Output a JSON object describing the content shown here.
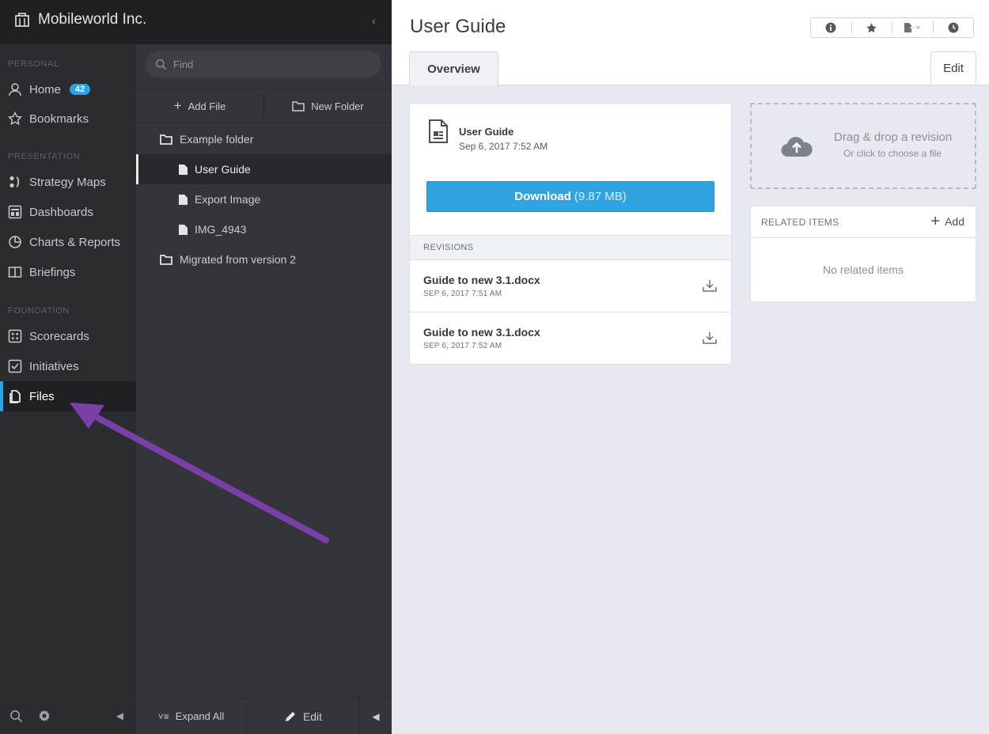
{
  "app": {
    "org_name": "Mobileworld Inc."
  },
  "nav": {
    "sections": {
      "personal": "PERSONAL",
      "presentation": "PRESENTATION",
      "foundation": "FOUNDATION"
    },
    "home": {
      "label": "Home",
      "badge": "42"
    },
    "bookmarks": "Bookmarks",
    "strategy_maps": "Strategy Maps",
    "dashboards": "Dashboards",
    "charts_reports": "Charts & Reports",
    "briefings": "Briefings",
    "scorecards": "Scorecards",
    "initiatives": "Initiatives",
    "files": "Files"
  },
  "files_panel": {
    "search_placeholder": "Find",
    "add_file": "Add File",
    "new_folder": "New Folder",
    "tree": [
      {
        "type": "folder",
        "label": "Example folder"
      },
      {
        "type": "file",
        "label": "User Guide",
        "selected": true
      },
      {
        "type": "file",
        "label": "Export Image"
      },
      {
        "type": "file",
        "label": "IMG_4943"
      },
      {
        "type": "folder",
        "label": "Migrated from version 2"
      }
    ],
    "expand_all": "Expand All",
    "edit": "Edit"
  },
  "main": {
    "title": "User Guide",
    "tab_overview": "Overview",
    "edit_button": "Edit",
    "file": {
      "name": "User Guide",
      "date": "Sep 6, 2017 7:52 AM"
    },
    "download": {
      "label": "Download",
      "size": "(9.87 MB)"
    },
    "revisions_header": "REVISIONS",
    "revisions": [
      {
        "name": "Guide to new 3.1.docx",
        "date": "SEP 6, 2017 7:51 AM"
      },
      {
        "name": "Guide to new 3.1.docx",
        "date": "SEP 6, 2017 7:52 AM"
      }
    ],
    "dropzone": {
      "title": "Drag & drop a revision",
      "subtitle": "Or click to choose a file"
    },
    "related": {
      "header": "RELATED ITEMS",
      "add": "Add",
      "empty": "No related items"
    }
  },
  "colors": {
    "accent": "#29a4e0",
    "annotation_arrow": "#7b3fa8"
  }
}
